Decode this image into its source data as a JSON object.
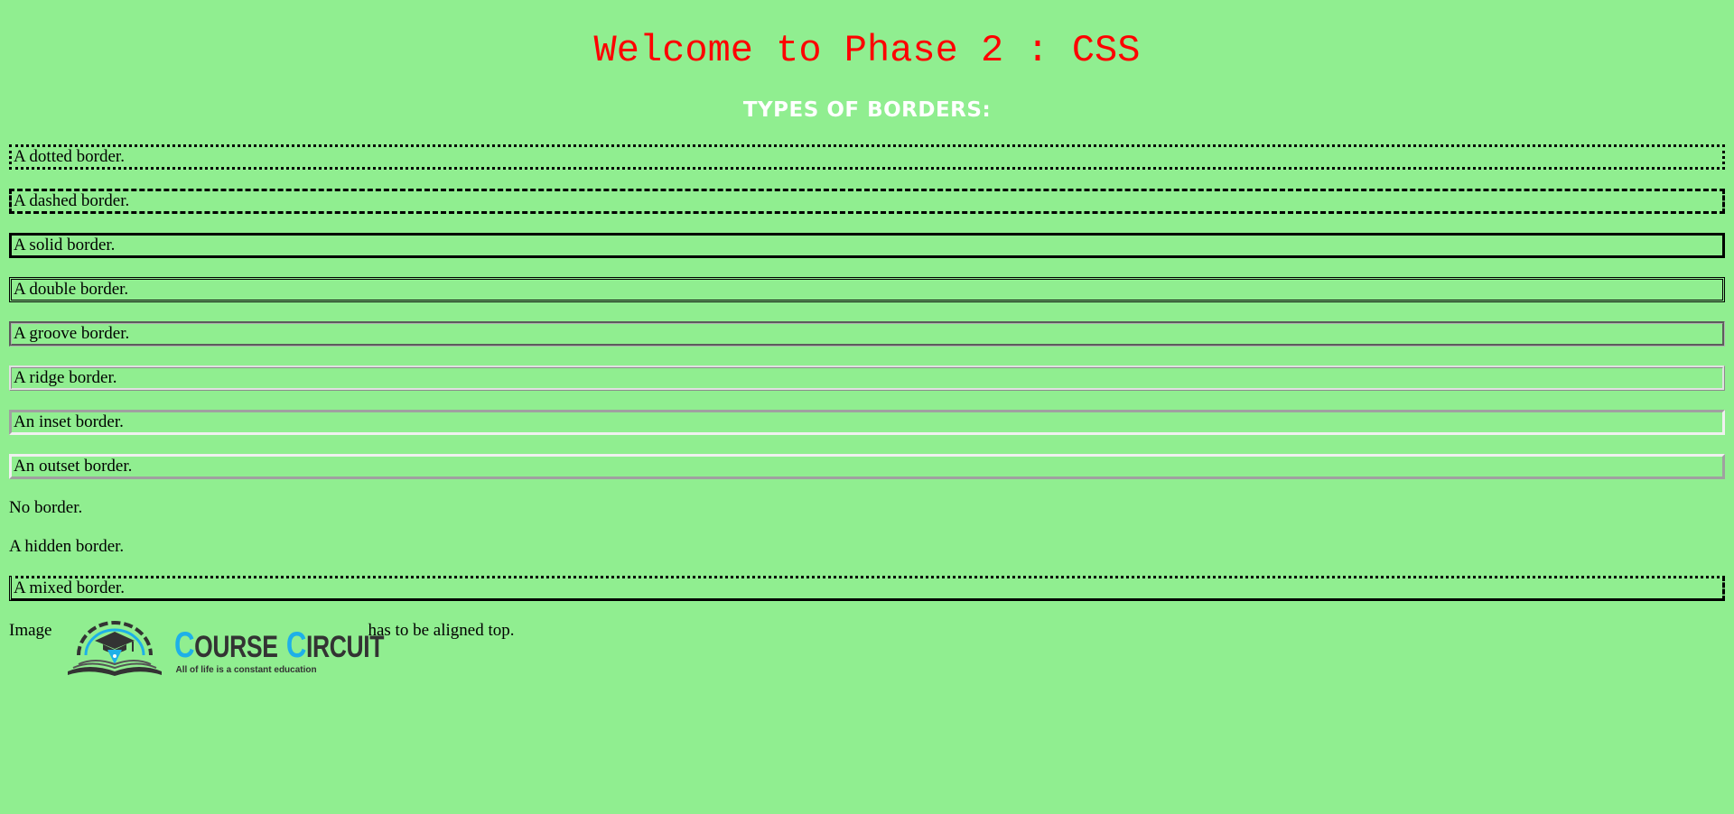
{
  "page": {
    "title": "Welcome to Phase 2 : CSS",
    "heading": "TYPES OF BORDERS:"
  },
  "colors": {
    "background": "#90EE90",
    "title": "#FF0000",
    "heading": "#FFFFFF",
    "text": "#000000",
    "logo_accent": "#1EB0E8",
    "logo_dark": "#333333"
  },
  "borders": [
    {
      "label": "A dotted border.",
      "style": "dotted"
    },
    {
      "label": "A dashed border.",
      "style": "dashed"
    },
    {
      "label": "A solid border.",
      "style": "solid"
    },
    {
      "label": "A double border.",
      "style": "double"
    },
    {
      "label": "A groove border.",
      "style": "groove"
    },
    {
      "label": "A ridge border.",
      "style": "ridge"
    },
    {
      "label": "An inset border.",
      "style": "inset"
    },
    {
      "label": "An outset border.",
      "style": "outset"
    }
  ],
  "no_border": {
    "label": "No border."
  },
  "hidden_border": {
    "label": "A hidden border."
  },
  "mixed_border": {
    "label": "A mixed border.",
    "style": "dotted dashed solid double"
  },
  "image_line": {
    "before": "Image",
    "after": "has to be aligned top.",
    "logo": {
      "name_first_initial": "C",
      "name_first_rest": "OURSE",
      "name_second_initial": "C",
      "name_second_rest": "IRCUIT",
      "tagline": "All of life is a constant education",
      "icon": "open-book-graduation-cap-icon"
    }
  }
}
